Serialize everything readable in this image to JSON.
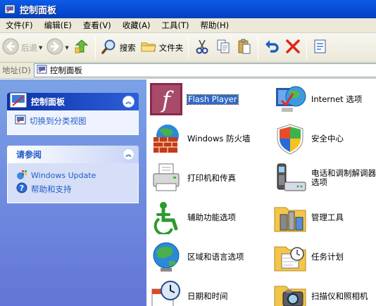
{
  "window": {
    "title": "控制面板",
    "icon": "control-panel-icon"
  },
  "menu": [
    "文件(F)",
    "编辑(E)",
    "查看(V)",
    "收藏(A)",
    "工具(T)",
    "帮助(H)"
  ],
  "toolbar": {
    "back_label": "后退",
    "search_label": "搜索",
    "folders_label": "文件夹"
  },
  "address": {
    "label": "地址(D)",
    "value": "控制面板"
  },
  "sidebar": {
    "panel1": {
      "title": "控制面板",
      "links": [
        {
          "label": "切换到分类视图",
          "icon": "switch-view-icon"
        }
      ]
    },
    "panel2": {
      "title": "请参阅",
      "links": [
        {
          "label": "Windows Update",
          "icon": "windows-update-icon"
        },
        {
          "label": "帮助和支持",
          "icon": "help-icon"
        }
      ]
    }
  },
  "items": [
    {
      "label": "Flash Player",
      "icon": "flash-player-icon",
      "selected": true
    },
    {
      "label": "Internet 选项",
      "icon": "internet-options-icon"
    },
    {
      "label": "Windows 防火墙",
      "icon": "firewall-icon"
    },
    {
      "label": "安全中心",
      "icon": "security-center-icon"
    },
    {
      "label": "打印机和传真",
      "icon": "printer-icon"
    },
    {
      "label": "电话和调制解调器选项",
      "icon": "phone-modem-icon"
    },
    {
      "label": "辅助功能选项",
      "icon": "accessibility-icon"
    },
    {
      "label": "管理工具",
      "icon": "admin-tools-icon"
    },
    {
      "label": "区域和语言选项",
      "icon": "regional-language-icon"
    },
    {
      "label": "任务计划",
      "icon": "scheduled-tasks-icon"
    },
    {
      "label": "日期和时间",
      "icon": "date-time-icon"
    },
    {
      "label": "扫描仪和照相机",
      "icon": "scanner-camera-icon"
    }
  ],
  "colors": {
    "title_bar": "#0a4fd8",
    "sidebar": "#7ba2e7",
    "link": "#215dc6",
    "selection": "#316ac5"
  }
}
